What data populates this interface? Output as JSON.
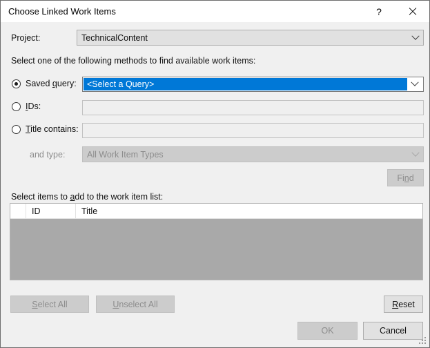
{
  "window": {
    "title": "Choose Linked Work Items",
    "help_icon": "help-question-icon",
    "help_label": "?",
    "close_icon": "close-icon"
  },
  "project": {
    "label": "Project:",
    "value": "TechnicalContent",
    "arrow_icon": "chevron-down-icon"
  },
  "instruction": "Select one of the following methods to find available work items:",
  "methods": {
    "saved_query": {
      "label_before": "Saved ",
      "label_accel": "q",
      "label_after": "uery:",
      "selected": true,
      "value": "<Select a Query>",
      "arrow_icon": "chevron-down-icon",
      "highlight_color": "#0078d7"
    },
    "ids": {
      "label_accel": "I",
      "label_after": "Ds:",
      "selected": false,
      "value": "",
      "placeholder": ""
    },
    "title_contains": {
      "label_accel": "T",
      "label_after": "itle contains:",
      "selected": false,
      "value": "",
      "placeholder": ""
    },
    "and_type": {
      "label": "and type:",
      "value": "All Work Item Types",
      "disabled": true,
      "arrow_icon": "chevron-down-icon"
    }
  },
  "find_button": {
    "label_before": "Fi",
    "label_accel": "n",
    "label_after": "d",
    "disabled": true
  },
  "list": {
    "caption_before": "Select items to ",
    "caption_accel": "a",
    "caption_after": "dd to the work item list:",
    "columns": [
      "",
      "ID",
      "Title"
    ],
    "rows": []
  },
  "actions": {
    "select_all": {
      "label_accel": "S",
      "label_after": "elect All",
      "disabled": true
    },
    "unselect_all": {
      "label_accel": "U",
      "label_after": "nselect All",
      "disabled": true
    },
    "reset": {
      "label_accel": "R",
      "label_after": "eset",
      "disabled": false
    },
    "ok": {
      "label": "OK",
      "disabled": true
    },
    "cancel": {
      "label": "Cancel",
      "disabled": false
    }
  },
  "resize_grip": "resize-grip-icon"
}
